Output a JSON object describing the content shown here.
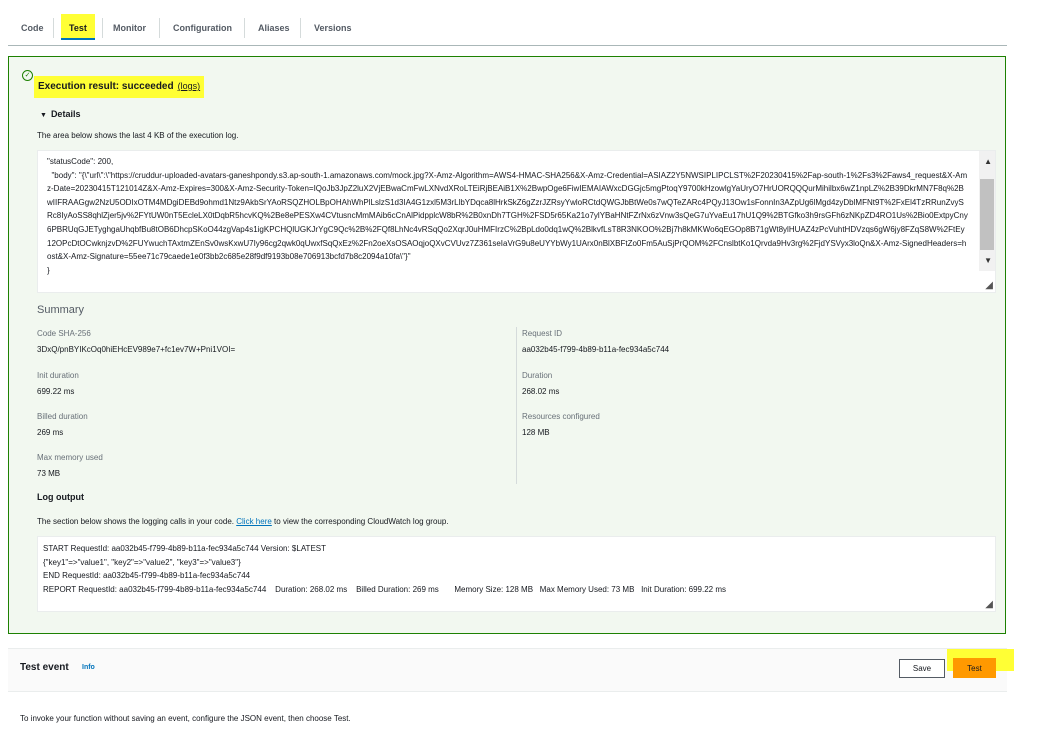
{
  "tabs": [
    "Code",
    "Test",
    "Monitor",
    "Configuration",
    "Aliases",
    "Versions"
  ],
  "result": {
    "title": "Execution result: succeeded",
    "logs_link": "(logs)",
    "details_label": "Details",
    "area_note": "The area below shows the last 4 KB of the execution log.",
    "log_lines": [
      "\"statusCode\": 200,",
      "  \"body\": \"{\\\"url\\\":\\\"https://cruddur-uploaded-avatars-ganeshpondy.s3.ap-south-1.amazonaws.com/mock.jpg?X-Amz-Algorithm=AWS4-HMAC-SHA256&X-Amz-Credential=ASIAZ2Y5NWSIPLIPCLST%2F20230415%2Fap-south-1%2Fs3%2Faws4_request&X-Amz-Date=20230415T121014Z&X-Amz-Expires=300&X-Amz-Security-Token=IQoJb3JpZ2luX2VjEBwaCmFwLXNvdXRoLTEiRjBEAiB1X%2BwpOge6FiwIEMAIAWxcDGGjc5mgPtoqY9700kHzowlgYaUryO7HrUORQQQurMihilbx6wZ1npLZ%2B39DkrMN7F8q%2BwIIFRAAGgw2NzU5ODIxOTM4MDgiDEBd9ohmd1Ntz9AkbSrYAoRSQZHOLBpOHAhWhPlLslzS1d3IA4G1zxl5M3rLlbYDqca8lHrkSkZ6gZzrJZRsyYwloRCtdQWGJbBtWe0s7wQTeZARc4PQyJ13Ow1sFonnIn3AZpUg6lMgd4zyDblMFNt9T%2FxEl4TzRRunZvySRc8IyAoSS8qhlZjer5jv%2FYtUW0nT5EcleLX0tDqbR5hcvKQ%2Be8ePESXw4CVtusncMmMAib6cCnAlPidpplcW8bR%2B0xnDh7TGH%2FSD5r65Ka21o7ylYBaHNtFZrNx6zVnw3sQeG7uYvaEu17hU1Q9%2BTGfko3h9rsGFh6zNKpZD4RO1Us%2Bio0ExtpyCny6PBRUqGJETyghgaUhqbfBu8tOB6DhcpSKoO44zgVap4s1igKPCHQlUGKJrYgC9Qc%2B%2FQf8LhNc4vRSqQo2XqrJ0uHMFIrzC%2BpLdo0dq1wQ%2BlkvfLsT8R3NKOO%2Bj7h8kMKWo6qEGOp8B71gWt8ylHUAZ4zPcVuhtHDVzqs6gW6jy8FZqS8W%2FtEy12OPcDtOCwknjzvD%2FUYwuchTAxtmZEnSv0wsKxwU7Iy96cg2qwk0qUwxfSqQxEz%2Fn2oeXsOSAOqjoQXvCVUvz7Z361seIaVrG9u8eUYYbWy1UArx0nBlXBFtZo0Fm5AuSjPrQOM%2FCnslbtKo1Qrvda9Hv3rg%2FjdYSVyx3loQn&X-Amz-SignedHeaders=host&X-Amz-Signature=55ee71c79caede1e0f3bb2c685e28f9df9193b08e706913bcfd7b8c2094a10fa\\\"}\"",
      "}"
    ]
  },
  "summary": {
    "title": "Summary",
    "items": [
      {
        "label": "Code SHA-256",
        "value": "3DxQ/pnBYIKcOq0hiEHcEV989e7+fc1ev7W+Pni1VOI="
      },
      {
        "label": "Request ID",
        "value": "aa032b45-f799-4b89-b11a-fec934a5c744"
      },
      {
        "label": "Init duration",
        "value": "699.22 ms"
      },
      {
        "label": "Duration",
        "value": "268.02 ms"
      },
      {
        "label": "Billed duration",
        "value": "269 ms"
      },
      {
        "label": "Resources configured",
        "value": "128 MB"
      },
      {
        "label": "Max memory used",
        "value": "73 MB"
      }
    ]
  },
  "log_output": {
    "title": "Log output",
    "note_before": "The section below shows the logging calls in your code.",
    "link": "Click here",
    "note_after": "to view the corresponding CloudWatch log group.",
    "lines": [
      "START RequestId: aa032b45-f799-4b89-b11a-fec934a5c744 Version: $LATEST",
      "{\"key1\"=>\"value1\", \"key2\"=>\"value2\", \"key3\"=>\"value3\"}",
      "END RequestId: aa032b45-f799-4b89-b11a-fec934a5c744",
      "REPORT RequestId: aa032b45-f799-4b89-b11a-fec934a5c744    Duration: 268.02 ms    Billed Duration: 269 ms       Memory Size: 128 MB   Max Memory Used: 73 MB   Init Duration: 699.22 ms"
    ]
  },
  "test_event": {
    "title": "Test event",
    "info": "Info",
    "save": "Save",
    "test": "Test",
    "note": "To invoke your function without saving an event, configure the JSON event, then choose Test."
  },
  "colors": {
    "success": "#1d8102",
    "highlight": "#ffff35",
    "primary_button": "#ff9900",
    "link": "#0073bb"
  }
}
